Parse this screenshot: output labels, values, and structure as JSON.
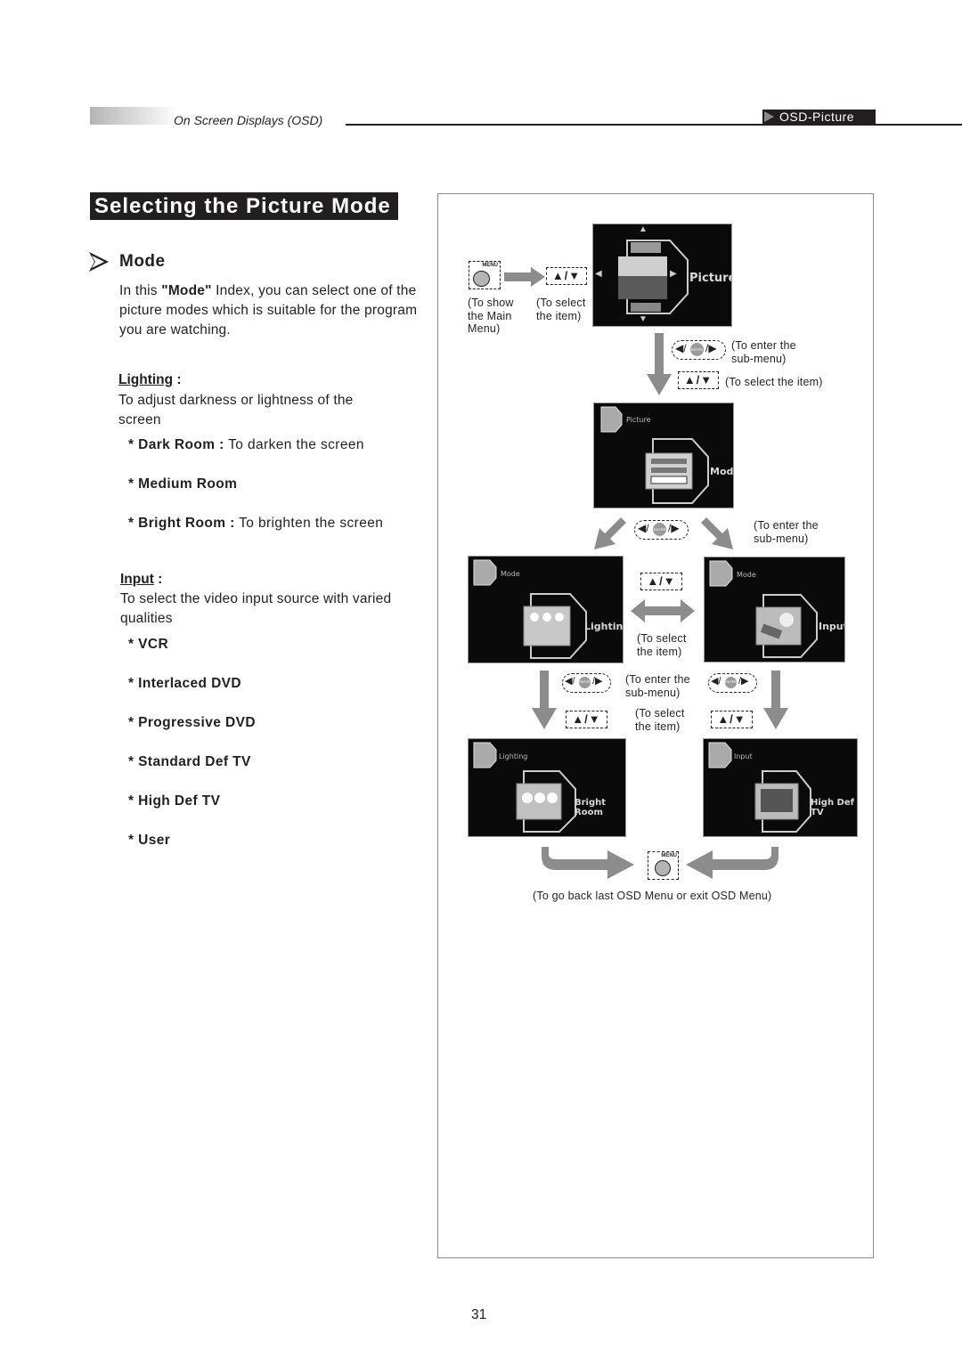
{
  "header": {
    "section": "On Screen Displays (OSD)",
    "tag": "OSD-Picture"
  },
  "title": "Selecting the Picture Mode",
  "mode": {
    "heading": "Mode",
    "intro_pre": "In this ",
    "intro_bold": "\"Mode\"",
    "intro_post": " Index, you can select one of the picture modes which is suitable for the program you are watching."
  },
  "lighting": {
    "heading": "Lighting",
    "colon": " :",
    "desc": "To adjust darkness or lightness of the screen",
    "items": [
      {
        "label": "* Dark Room :",
        "desc": " To darken the screen"
      },
      {
        "label": "* Medium Room",
        "desc": ""
      },
      {
        "label": "* Bright Room :",
        "desc": " To brighten the screen"
      }
    ]
  },
  "input": {
    "heading": "Input",
    "colon": " :",
    "desc": "To select the video input source with varied qualities",
    "items": [
      {
        "label": "* VCR"
      },
      {
        "label": "* Interlaced DVD"
      },
      {
        "label": "* Progressive DVD"
      },
      {
        "label": "* Standard Def TV"
      },
      {
        "label": "* High Def TV"
      },
      {
        "label": "* User"
      }
    ]
  },
  "diagram": {
    "menu_key": "MENU",
    "enter_key": "ENTER",
    "updown_keys": "▲/▼",
    "captions": {
      "show_main_menu": "(To show the Main Menu)",
      "select_item_1": "(To select the item)",
      "enter_submenu_1": "(To enter the sub-menu)",
      "select_item_2": "(To select the item)",
      "enter_submenu_2": "(To enter the sub-menu)",
      "select_item_3": "(To select the item)",
      "enter_submenu_3": "(To enter the sub-menu)",
      "select_item_4": "(To select the item)",
      "go_back": "(To go back last OSD Menu or exit OSD Menu)"
    },
    "screens": {
      "picture": {
        "label": "Picture"
      },
      "mode": {
        "corner": "Picture",
        "label": "Mode"
      },
      "lighting": {
        "corner": "Mode",
        "label": "Lighting"
      },
      "input": {
        "corner": "Mode",
        "label": "Input"
      },
      "bright_room": {
        "corner": "Lighting",
        "label": "Bright Room"
      },
      "high_def_tv": {
        "corner": "Input",
        "label": "High Def TV"
      }
    }
  },
  "page_number": "31"
}
